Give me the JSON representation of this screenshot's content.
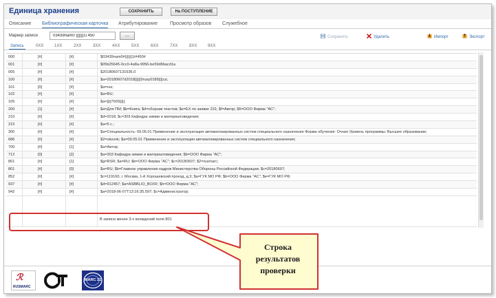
{
  "header": {
    "title": "Единица хранения",
    "save_label": "СОХРАНИТЬ",
    "receipt_label": "На ПОСТУПЛЕНИЕ"
  },
  "tabs": [
    {
      "label": "Описание"
    },
    {
      "label": "Библиографическая карточка"
    },
    {
      "label": "Атрибутирование"
    },
    {
      "label": "Просмотр образов"
    },
    {
      "label": "Служебное"
    }
  ],
  "marker": {
    "label": "Маркер записи",
    "value": "03439nam0 |||||||1i 450",
    "browse_label": "..."
  },
  "actions": {
    "save": "Сохранить",
    "delete": "Удалить",
    "import": "Импорт",
    "export": "Экспорт"
  },
  "subtabs": [
    "Запись",
    "0XX",
    "1XX",
    "2XX",
    "3XX",
    "4XX",
    "5XX",
    "6XX",
    "7XX",
    "8XX",
    "9XX"
  ],
  "rows": [
    {
      "tag": "000",
      "ind1": "[#]",
      "ind2": "[#]",
      "value": "$03439nam0#|||||||1i#450#"
    },
    {
      "tag": "001",
      "ind1": "[#]",
      "ind2": "[#]",
      "value": "$05b25645-0cc0-4a8a-9956-be59d6bacd1a"
    },
    {
      "tag": "005",
      "ind1": "[#]",
      "ind2": "[#]",
      "value": "$20180607131636.0"
    },
    {
      "tag": "100",
      "ind1": "[#]",
      "ind2": "[#]",
      "value": "$a=20180607d2018||||||0rusy0189||||ca;"
    },
    {
      "tag": "101",
      "ind1": "[0]",
      "ind2": "[#]",
      "value": "$a=rus;"
    },
    {
      "tag": "102",
      "ind1": "[#]",
      "ind2": "[#]",
      "value": "$a=RU;"
    },
    {
      "tag": "105",
      "ind1": "[#]",
      "ind2": "[#]",
      "value": "$a=||||7000|||||;"
    },
    {
      "tag": "200",
      "ind1": "[1]",
      "ind2": "[#]",
      "value": "$a=Для ПМ; $b=Книга; $d=сборник текстов; $e=EX по заявке 231; $f=Автор; $5=ООО Фирма \"АС\";"
    },
    {
      "tag": "210",
      "ind1": "[#]",
      "ind2": "[#]",
      "value": "$d=2018; $c=303 Кафедра химии и материаловедения;"
    },
    {
      "tag": "215",
      "ind1": "[#]",
      "ind2": "[#]",
      "value": "$a=5 c.;"
    },
    {
      "tag": "300",
      "ind1": "[#]",
      "ind2": "[#]",
      "value": "$a=Специальность: 09.05.01 Применение и эксплуатация автоматизированных систем специального назначения Форма обучения: Очная Уровень программы: Высшее образование;"
    },
    {
      "tag": "686",
      "ind1": "[#]",
      "ind2": "[#]",
      "value": "$2=oksvnk; $a=09.05.01 Применение и эксплуатация автоматизированных систем специального назначения;"
    },
    {
      "tag": "700",
      "ind1": "[#]",
      "ind2": "[1]",
      "value": "$a=Автор;"
    },
    {
      "tag": "712",
      "ind1": "[0]",
      "ind2": "[2]",
      "value": "$a=303 Кафедра химии и материаловедения; $b=ООО Фирма \"АС\";"
    },
    {
      "tag": "801",
      "ind1": "[#]",
      "ind2": "[1]",
      "value": "$g=RSR; $a=RU; $b=ООО Фирма \"АС\"; $c=20180607; $2=rusmarc;"
    },
    {
      "tag": "801",
      "ind1": "[#]",
      "ind2": "[0]",
      "value": "$a=RU; $b=Главное управление кадров Министерства Обороны Российской Федерации; $c=20180607;"
    },
    {
      "tag": "852",
      "ind1": "[#]",
      "ind2": "[#]",
      "value": "$c=119160, г. Москва, 1-й Хорошевский проезд, д.3; $a=ГУК МО РФ; $b=ООО Фирма \"АС\"; $e=ГУК МО РФ;"
    },
    {
      "tag": "937",
      "ind1": "[#]",
      "ind2": "[#]",
      "value": "$d=912457; $a=ASBBLIO_BOXF; $h=ООО Фирма \"АС\";"
    },
    {
      "tag": "942",
      "ind1": "[#]",
      "ind2": "[#]",
      "value": "$a=2018-06-07T13:16:35.597; $c=Администратор;"
    }
  ],
  "result": {
    "text": "В записи менее 3-х вхождений поля 801"
  },
  "callout": {
    "text": "Строка\nрезультатов\nпроверки",
    "border_color": "#d03030",
    "fill_color": "#fffcd0"
  },
  "footer": {
    "rusmarc_label": "RUSMARC",
    "marc21_label": "MARC 21"
  },
  "colors": {
    "accent": "#2e6aa8",
    "title": "#1a3d8a",
    "delete": "#d02020"
  }
}
